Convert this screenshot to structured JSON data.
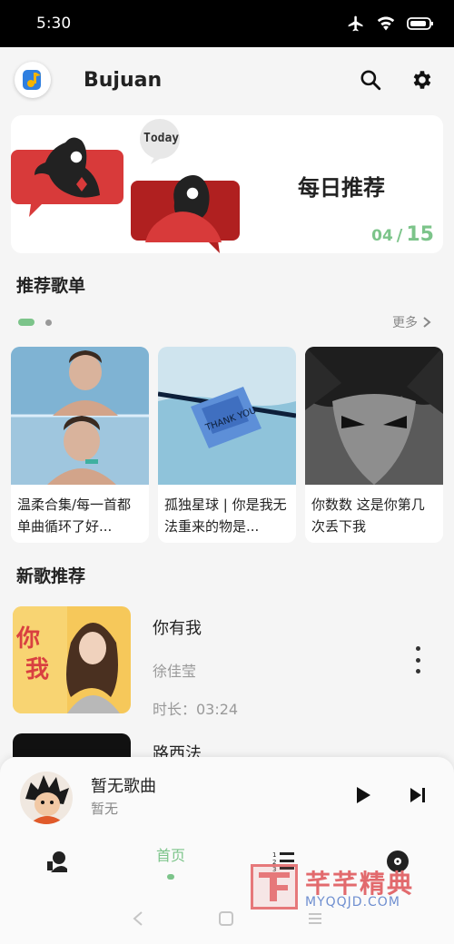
{
  "status_bar": {
    "time": "5:30"
  },
  "app": {
    "title": "Bujuan"
  },
  "daily": {
    "tag": "Today",
    "title": "每日推荐",
    "month": "04",
    "separator": "/",
    "day": "15"
  },
  "playlists": {
    "section_title": "推荐歌单",
    "more_label": "更多",
    "items": [
      {
        "label": "温柔合集/每一首都单曲循环了好..."
      },
      {
        "label": "孤独星球 | 你是我无法重来的物是..."
      },
      {
        "label": "你数数 这是你第几次丢下我"
      }
    ]
  },
  "new_songs": {
    "section_title": "新歌推荐",
    "items": [
      {
        "name": "你有我",
        "artist": "徐佳莹",
        "duration": "时长：03:24"
      },
      {
        "name": "路西法"
      }
    ]
  },
  "player": {
    "song": "暂无歌曲",
    "artist": "暂无"
  },
  "tabs": {
    "home_label": "首页"
  },
  "watermark": {
    "cn": "芊芊精典",
    "en": "MYQQJD.COM"
  },
  "colors": {
    "accent": "#7cc48a",
    "status_bar": "#000000"
  }
}
